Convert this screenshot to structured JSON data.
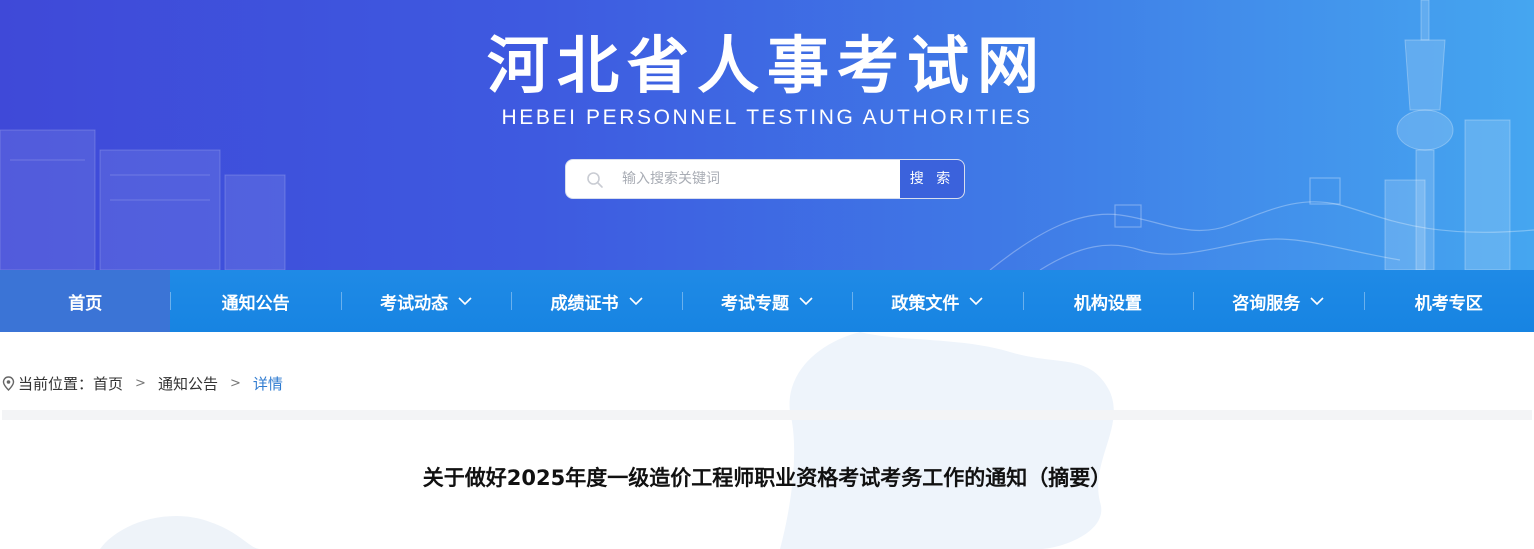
{
  "header": {
    "title": "河北省人事考试网",
    "subtitle": "HEBEI PERSONNEL TESTING AUTHORITIES"
  },
  "search": {
    "placeholder": "输入搜索关键词",
    "button_label": "搜 索",
    "icon": "search-icon"
  },
  "nav": {
    "items": [
      {
        "label": "首页",
        "dropdown": false,
        "active": true
      },
      {
        "label": "通知公告",
        "dropdown": false
      },
      {
        "label": "考试动态",
        "dropdown": true
      },
      {
        "label": "成绩证书",
        "dropdown": true
      },
      {
        "label": "考试专题",
        "dropdown": true
      },
      {
        "label": "政策文件",
        "dropdown": true
      },
      {
        "label": "机构设置",
        "dropdown": false
      },
      {
        "label": "咨询服务",
        "dropdown": true
      },
      {
        "label": "机考专区",
        "dropdown": false
      }
    ]
  },
  "breadcrumb": {
    "prefix": "当前位置：",
    "items": [
      "首页",
      "通知公告",
      "详情"
    ],
    "separator": ">"
  },
  "article": {
    "title": "关于做好2025年度一级造价工程师职业资格考试考务工作的通知（摘要）"
  },
  "colors": {
    "banner_start": "#3f49d8",
    "banner_end": "#45a6f0",
    "nav_bg": "#1784e2",
    "nav_active": "#3b74d6",
    "breadcrumb_current": "#2f7bd0"
  }
}
